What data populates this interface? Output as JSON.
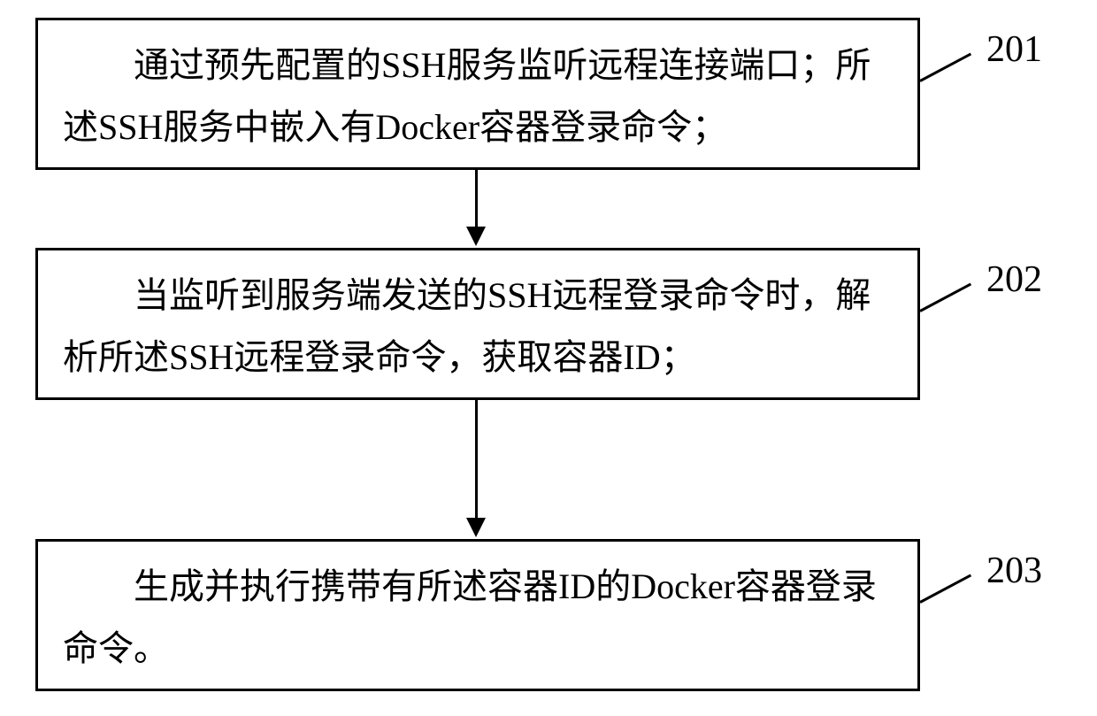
{
  "chart_data": {
    "type": "flowchart",
    "direction": "top-to-bottom",
    "nodes": [
      {
        "id": "201",
        "text": "　　通过预先配置的SSH服务监听远程连接端口；所述SSH服务中嵌入有Docker容器登录命令；"
      },
      {
        "id": "202",
        "text": "　　当监听到服务端发送的SSH远程登录命令时，解析所述SSH远程登录命令，获取容器ID；"
      },
      {
        "id": "203",
        "text": "　　生成并执行携带有所述容器ID的Docker容器登录命令。"
      }
    ],
    "edges": [
      {
        "from": "201",
        "to": "202"
      },
      {
        "from": "202",
        "to": "203"
      }
    ]
  },
  "labels": {
    "n201": "201",
    "n202": "202",
    "n203": "203"
  }
}
